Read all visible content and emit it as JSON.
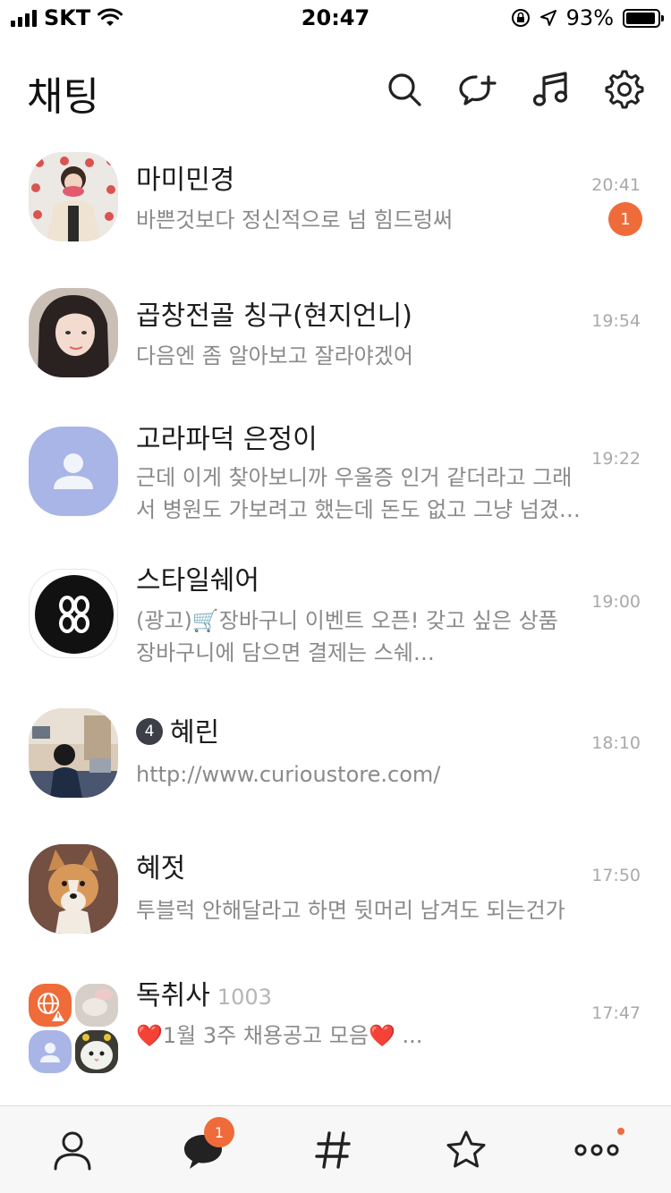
{
  "status_bar": {
    "carrier": "SKT",
    "time": "20:47",
    "battery": "93%",
    "battery_level": 0.93
  },
  "header": {
    "title": "채팅",
    "icons": [
      "search-icon",
      "new-chat-icon",
      "music-icon",
      "settings-icon"
    ]
  },
  "chats": [
    {
      "name": "마미민경",
      "message": "바쁜것보다 정신적으로 넘 힘드렁써",
      "time": "20:41",
      "unread": "1",
      "avatar": "photo"
    },
    {
      "name": "곱창전골 칭구(현지언니)",
      "message": "다음엔 좀 알아보고 잘라야겠어",
      "time": "19:54",
      "avatar": "photo"
    },
    {
      "name": "고라파덕 은정이",
      "message": "근데 이게 찾아보니까 우울증 인거 같더라고 그래서 병원도 가보려고 했는데 돈도 없고 그냥 넘겼…",
      "time": "19:22",
      "avatar": "default"
    },
    {
      "name": "스타일쉐어",
      "message": "(광고)🛒장바구니 이벤트 오픈! 갖고 싶은 상품 장바구니에 담으면 결제는 스쉐…",
      "time": "19:00",
      "avatar": "logo"
    },
    {
      "name": "혜린",
      "badge": "4",
      "message": "http://www.curioustore.com/",
      "time": "18:10",
      "avatar": "photo"
    },
    {
      "name": "혜젓",
      "message": "투블럭 안해달라고 하면 뒷머리 남겨도 되는건가",
      "time": "17:50",
      "avatar": "photo"
    },
    {
      "name": "독취사",
      "member_count": "1003",
      "message": "❤️1월 3주 채용공고 모음❤️ ...",
      "time": "17:47",
      "avatar": "group"
    }
  ],
  "tabbar": {
    "tabs": [
      "friends-tab",
      "chats-tab",
      "hashtag-tab",
      "favorites-tab",
      "more-tab"
    ],
    "chat_badge": "1"
  },
  "colors": {
    "accent": "#ef6b3a",
    "default_avatar": "#a8b5e6"
  }
}
